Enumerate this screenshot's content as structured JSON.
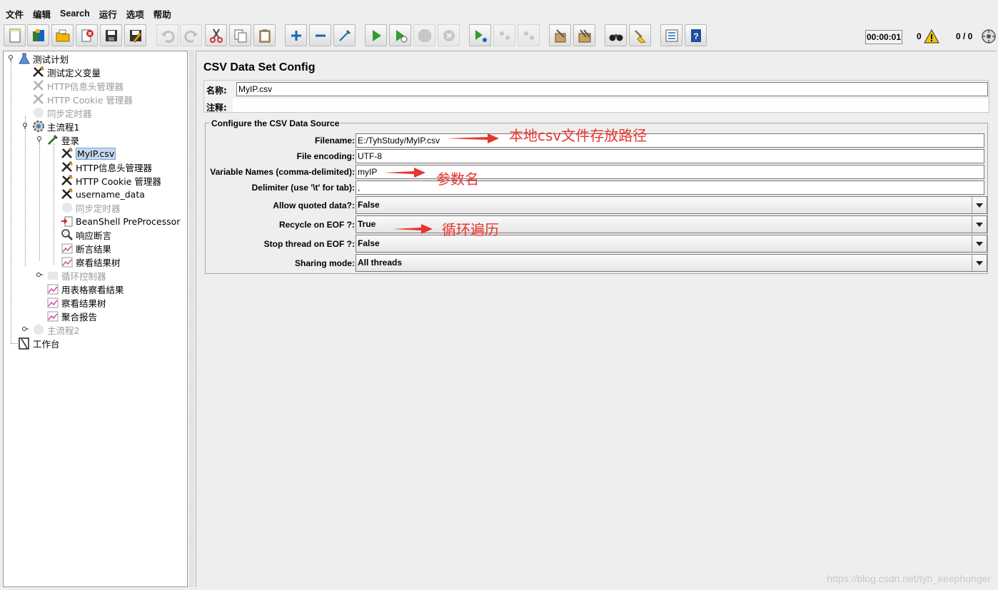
{
  "menu": [
    "文件",
    "编辑",
    "Search",
    "运行",
    "选项",
    "帮助"
  ],
  "toolbar": {
    "timer": "00:00:01",
    "error_count": "0",
    "threads": "0 / 0"
  },
  "tree": [
    {
      "label": "测试计划",
      "icon": "test-plan-icon"
    },
    {
      "label": "测试定义变量",
      "icon": "config-wrench-icon"
    },
    {
      "label": "HTTP信息头管理器",
      "icon": "config-wrench-icon"
    },
    {
      "label": "HTTP Cookie 管理器",
      "icon": "config-wrench-icon"
    },
    {
      "label": "同步定时器",
      "icon": "timer-icon"
    },
    {
      "label": "主流程1",
      "icon": "thread-group-icon"
    },
    {
      "label": "登录",
      "icon": "sampler-pipette-icon"
    },
    {
      "label": "MyIP.csv",
      "icon": "config-wrench-icon"
    },
    {
      "label": "HTTP信息头管理器",
      "icon": "config-wrench-icon"
    },
    {
      "label": "HTTP Cookie 管理器",
      "icon": "config-wrench-icon"
    },
    {
      "label": "username_data",
      "icon": "config-wrench-icon"
    },
    {
      "label": "同步定时器",
      "icon": "timer-icon"
    },
    {
      "label": "BeanShell PreProcessor",
      "icon": "preprocessor-icon"
    },
    {
      "label": "响应断言",
      "icon": "magnifier-icon"
    },
    {
      "label": "断言结果",
      "icon": "listener-graph-icon"
    },
    {
      "label": "察看结果树",
      "icon": "listener-graph-icon"
    },
    {
      "label": "循环控制器",
      "icon": "controller-icon"
    },
    {
      "label": "用表格察看结果",
      "icon": "listener-graph-icon"
    },
    {
      "label": "察看结果树",
      "icon": "listener-graph-icon"
    },
    {
      "label": "聚合报告",
      "icon": "listener-graph-icon"
    },
    {
      "label": "主流程2",
      "icon": "thread-group-icon"
    },
    {
      "label": "工作台",
      "icon": "workbench-icon"
    }
  ],
  "panel": {
    "title": "CSV Data Set Config",
    "name_label": "名称:",
    "name_value": "MyIP.csv",
    "comment_label": "注释:",
    "group_title": "Configure the CSV Data Source",
    "fields": {
      "filename_label": "Filename:",
      "filename_value": "E:/TyhStudy/MyIP.csv",
      "encoding_label": "File encoding:",
      "encoding_value": "UTF-8",
      "varnames_label": "Variable Names (comma-delimited):",
      "varnames_value": "myIP",
      "delimiter_label": "Delimiter (use '\\t' for tab):",
      "delimiter_value": ",",
      "quoted_label": "Allow quoted data?:",
      "quoted_value": "False",
      "recycle_label": "Recycle on EOF ?:",
      "recycle_value": "True",
      "stop_label": "Stop thread on EOF ?:",
      "stop_value": "False",
      "sharing_label": "Sharing mode:",
      "sharing_value": "All threads"
    }
  },
  "annotations": {
    "filename_note": "本地csv文件存放路径",
    "varnames_note": "参数名",
    "recycle_note": "循环遍历"
  },
  "watermark": "https://blog.csdn.net/tyh_keephunger"
}
